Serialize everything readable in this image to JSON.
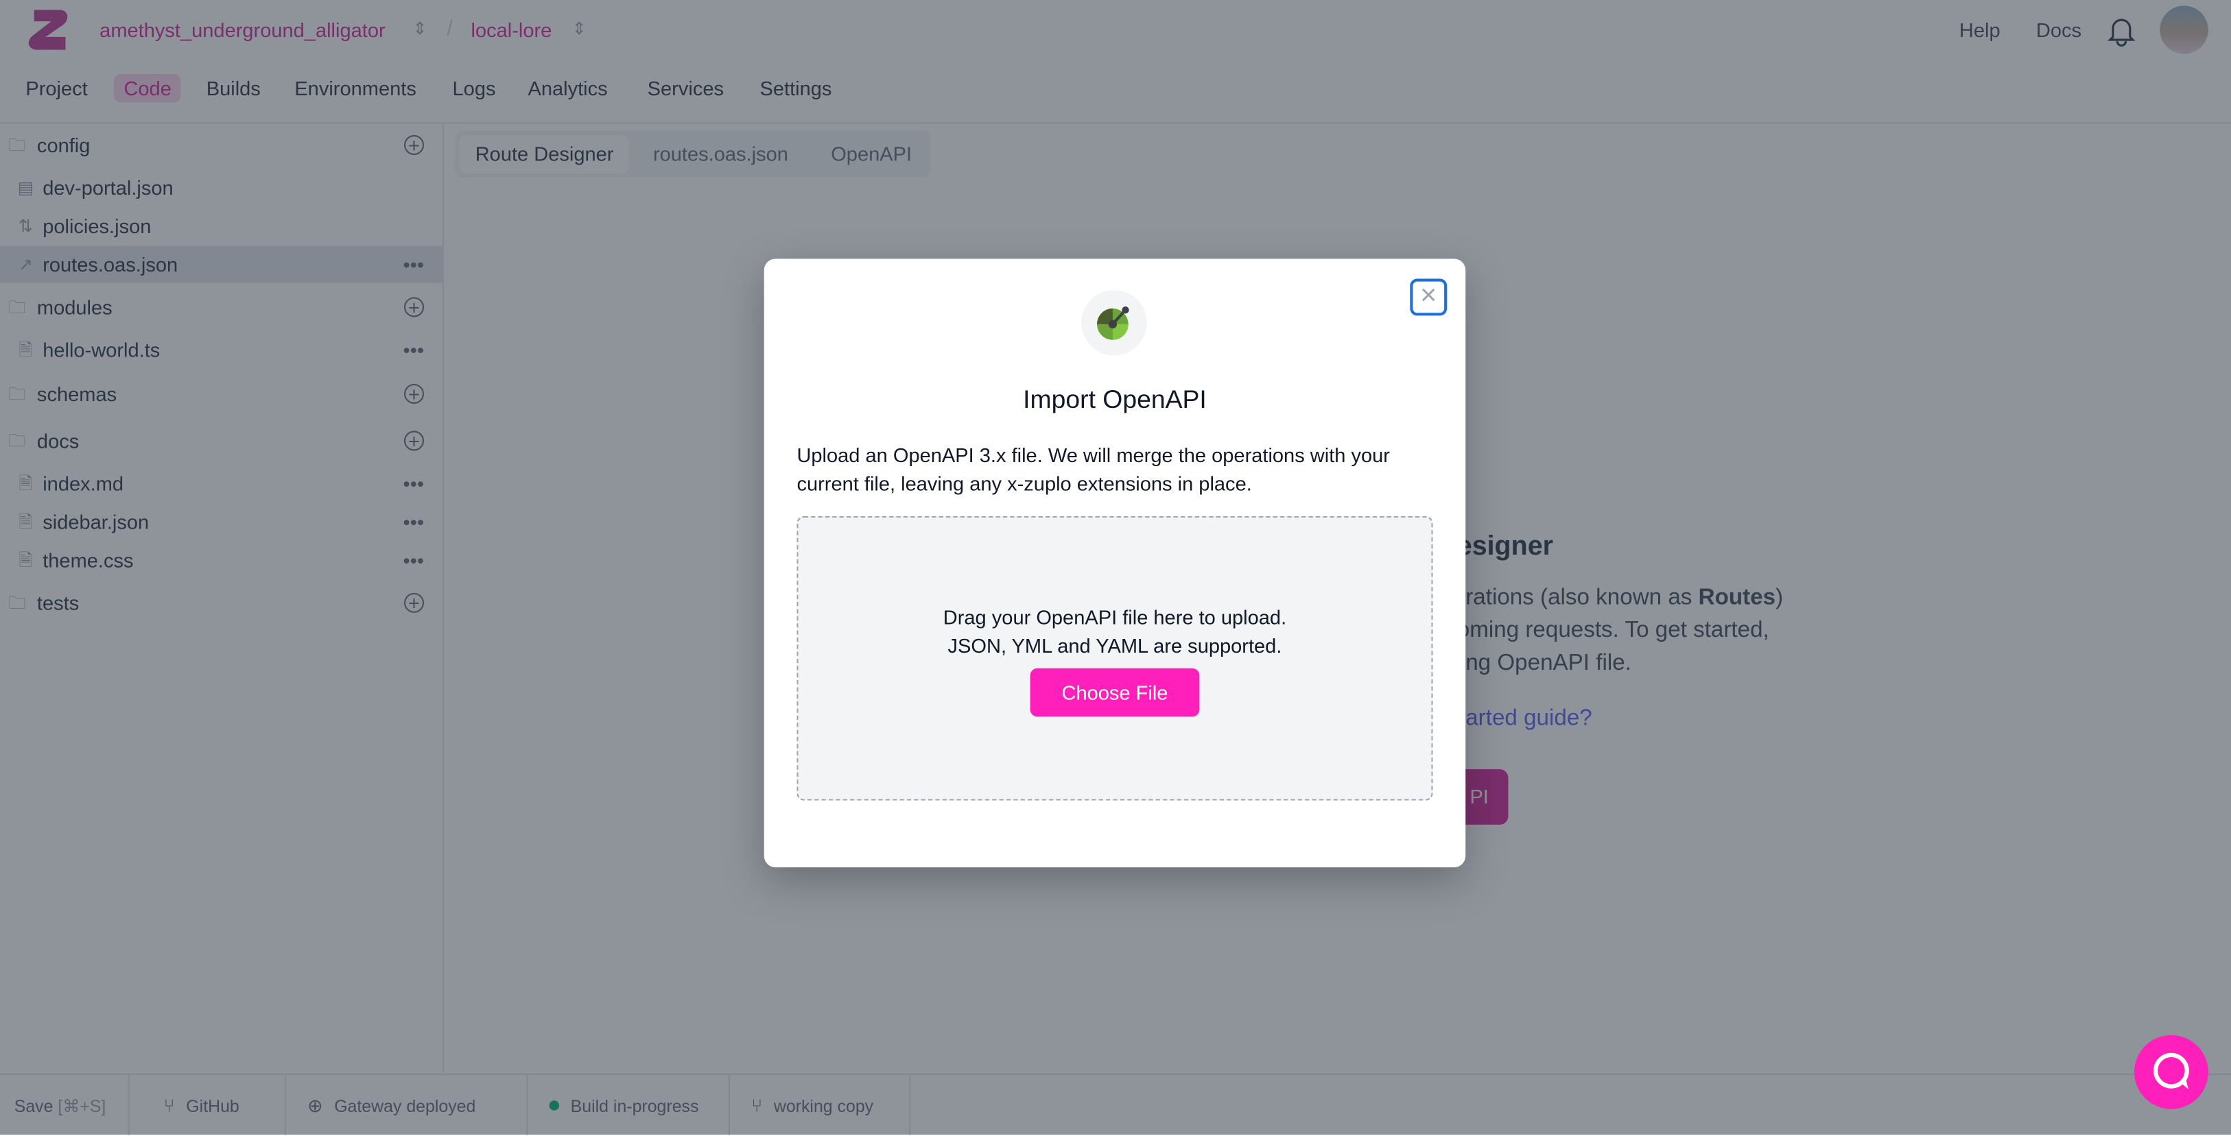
{
  "header": {
    "project": "amethyst_underground_alligator",
    "environment": "local-lore",
    "separator": "/",
    "links": [
      "Help",
      "Docs"
    ]
  },
  "nav": [
    "Project",
    "Code",
    "Builds",
    "Environments",
    "Logs",
    "Analytics",
    "Services",
    "Settings"
  ],
  "nav_active": "Code",
  "sidebar": {
    "items": [
      {
        "type": "folder",
        "label": "config"
      },
      {
        "type": "file",
        "label": "dev-portal.json",
        "icon": "layout-icon"
      },
      {
        "type": "file",
        "label": "policies.json",
        "icon": "arrows-up-down-icon"
      },
      {
        "type": "file",
        "label": "routes.oas.json",
        "icon": "route-icon",
        "selected": true
      },
      {
        "type": "folder",
        "label": "modules"
      },
      {
        "type": "file",
        "label": "hello-world.ts"
      },
      {
        "type": "folder",
        "label": "schemas"
      },
      {
        "type": "folder",
        "label": "docs"
      },
      {
        "type": "file",
        "label": "index.md"
      },
      {
        "type": "file",
        "label": "sidebar.json"
      },
      {
        "type": "file",
        "label": "theme.css"
      },
      {
        "type": "folder",
        "label": "tests"
      }
    ]
  },
  "editor_tabs": [
    "Route Designer",
    "routes.oas.json",
    "OpenAPI"
  ],
  "background": {
    "title_fragment": "esigner",
    "line1_fragment": "rations (also known as ",
    "line1_bold": "Routes",
    "line1_end": ")",
    "line2_fragment": "oming requests. To get started,",
    "line3_fragment": "ng OpenAPI file.",
    "link_fragment": "arted guide?",
    "button_fragment": "PI"
  },
  "modal": {
    "title": "Import OpenAPI",
    "description": "Upload an OpenAPI 3.x file. We will merge the operations with your current file, leaving any x-zuplo extensions in place.",
    "drop_line1": "Drag your OpenAPI file here to upload.",
    "drop_line2": "JSON, YML and YAML are supported.",
    "choose_button": "Choose File",
    "close": "×"
  },
  "statusbar": {
    "save": "Save",
    "save_shortcut": "[⌘+S]",
    "github": "GitHub",
    "gateway": "Gateway deployed",
    "build": "Build in-progress",
    "branch": "working copy"
  },
  "colors": {
    "accent": "#ff1fbb",
    "focus": "#1d6fdc",
    "build_status": "#10b981"
  }
}
